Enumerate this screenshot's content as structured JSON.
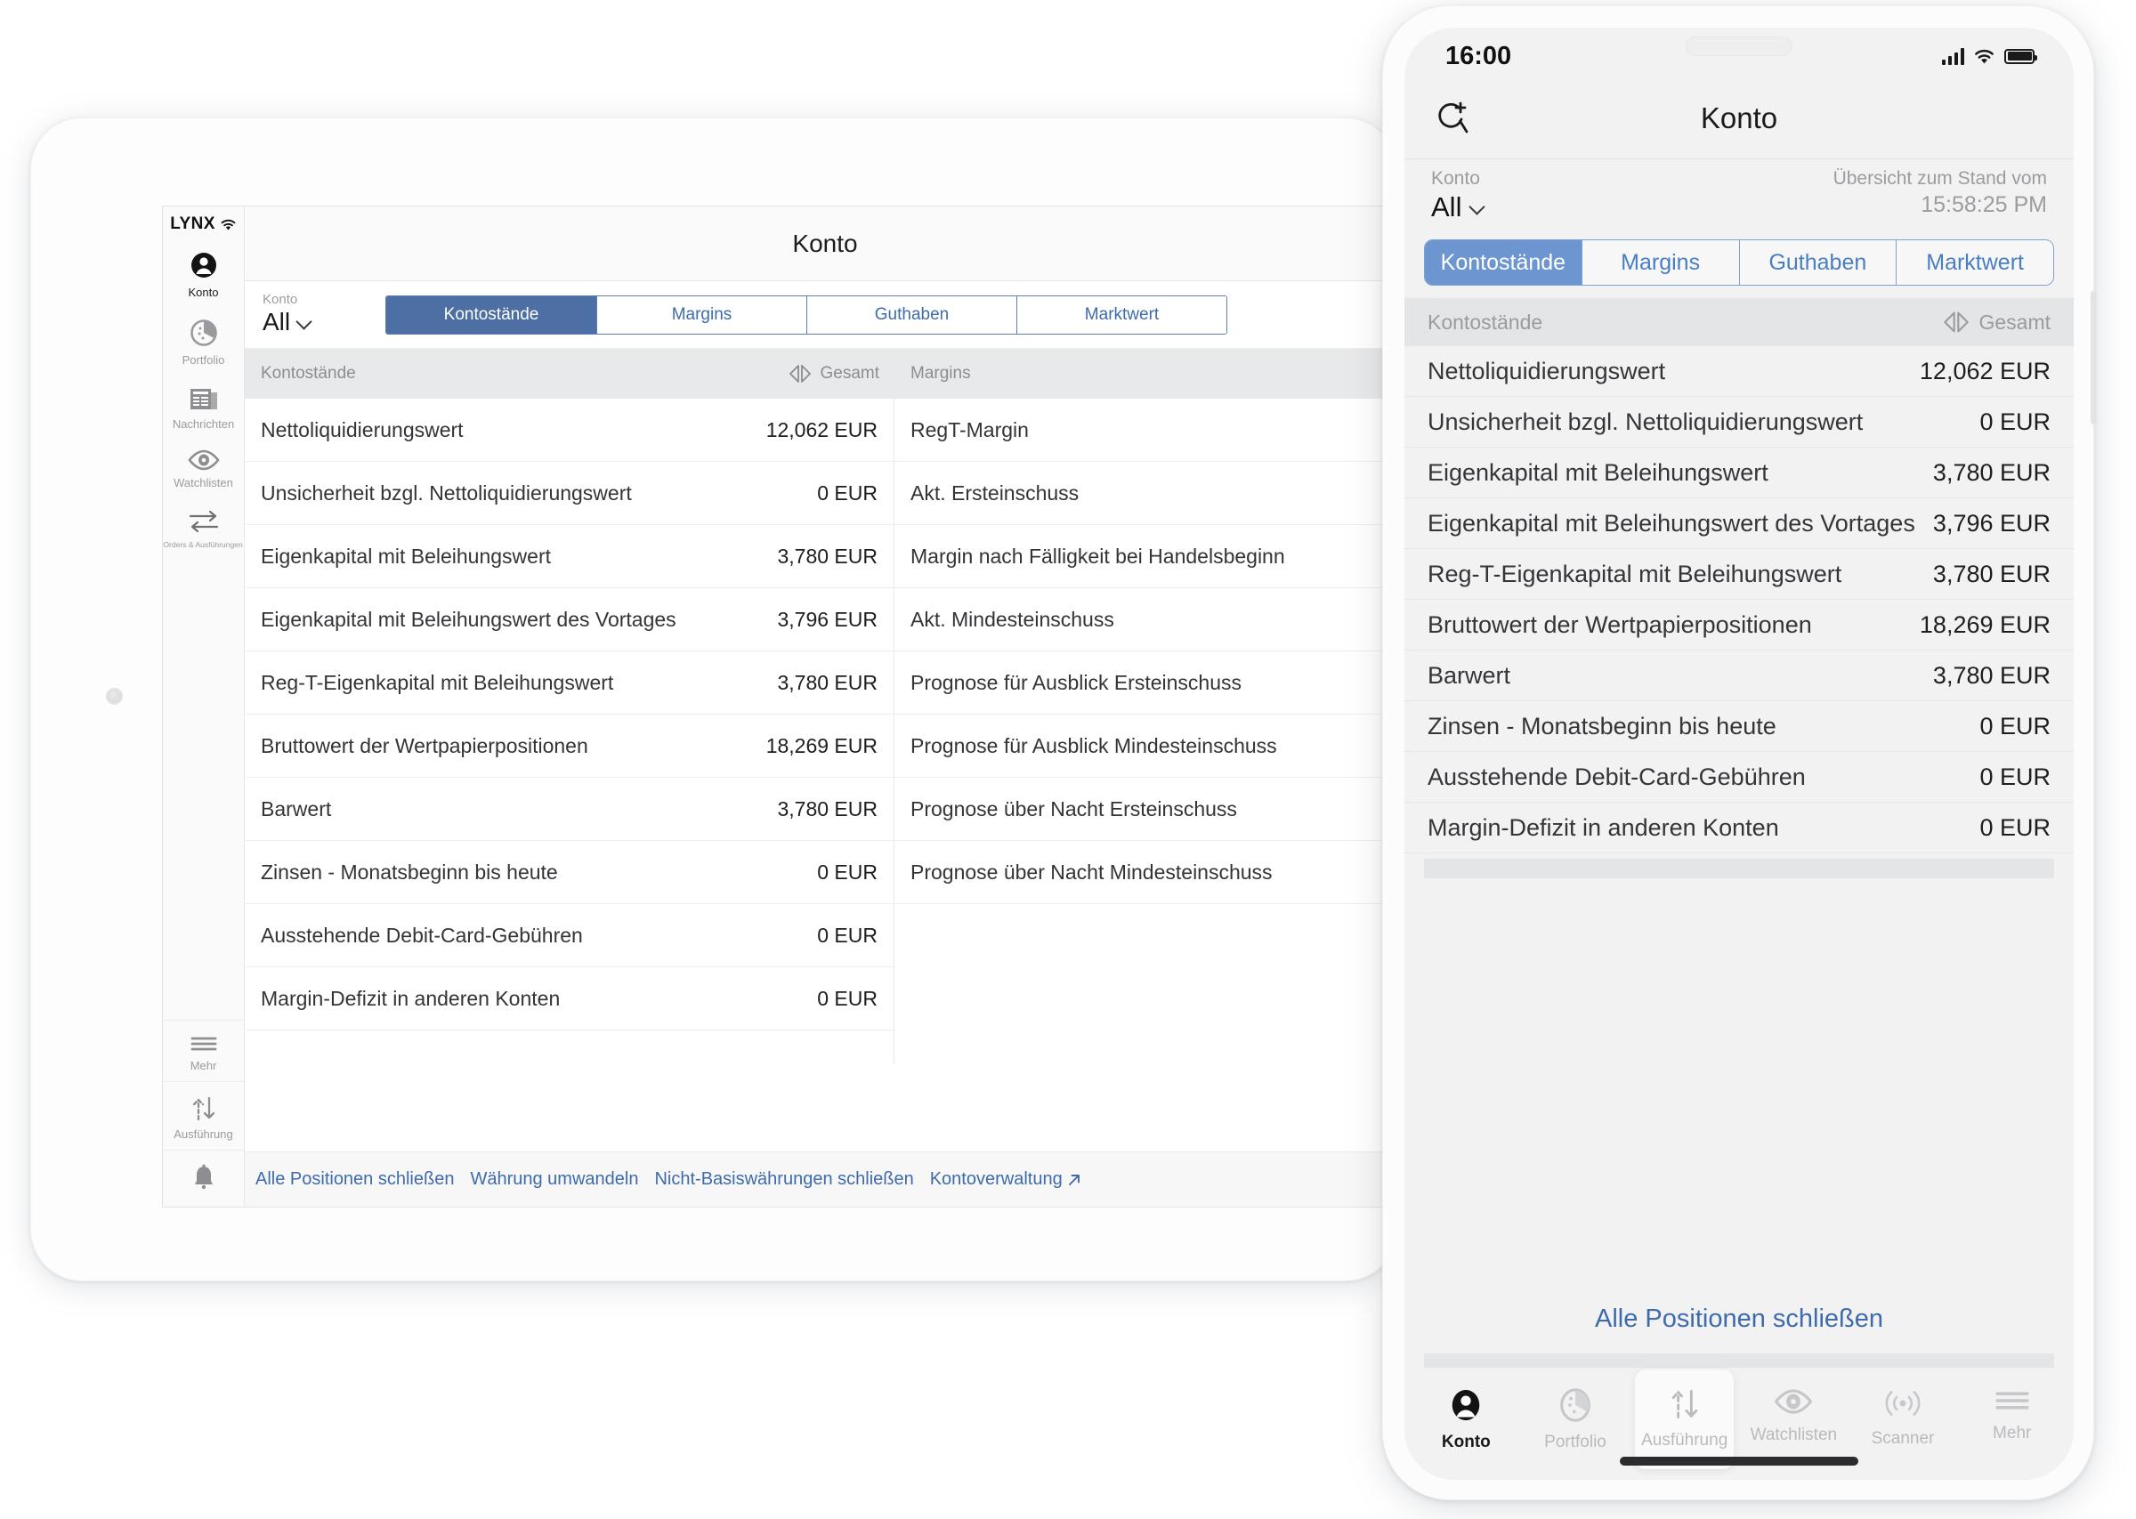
{
  "tablet": {
    "brand": "LYNX",
    "header_title": "Konto",
    "account": {
      "caption": "Konto",
      "value": "All"
    },
    "sidebar": [
      {
        "label": "Konto",
        "icon": "person-icon",
        "active": true
      },
      {
        "label": "Portfolio",
        "icon": "portfolio-pie-icon",
        "active": false
      },
      {
        "label": "Nachrichten",
        "icon": "news-icon",
        "active": false
      },
      {
        "label": "Watchlisten",
        "icon": "eye-icon",
        "active": false
      },
      {
        "label": "Orders & Ausführungen",
        "icon": "transfer-arrows-icon",
        "active": false
      }
    ],
    "sidebar_bottom": [
      {
        "label": "Mehr",
        "icon": "hamburger-icon"
      },
      {
        "label": "Ausführung",
        "icon": "up-down-arrows-icon"
      },
      {
        "label": "",
        "icon": "bell-icon"
      }
    ],
    "tabs": [
      {
        "label": "Kontostände",
        "active": true
      },
      {
        "label": "Margins",
        "active": false
      },
      {
        "label": "Guthaben",
        "active": false
      },
      {
        "label": "Marktwert",
        "active": false
      }
    ],
    "panel_kontostaende": {
      "header_title": "Kontostände",
      "header_right": "Gesamt",
      "rows": [
        {
          "label": "Nettoliquidierungswert",
          "value": "12,062 EUR"
        },
        {
          "label": "Unsicherheit bzgl. Nettoliquidierungswert",
          "value": "0 EUR"
        },
        {
          "label": "Eigenkapital mit Beleihungswert",
          "value": "3,780 EUR"
        },
        {
          "label": "Eigenkapital mit Beleihungswert des Vortages",
          "value": "3,796 EUR"
        },
        {
          "label": "Reg-T-Eigenkapital mit Beleihungswert",
          "value": "3,780 EUR"
        },
        {
          "label": "Bruttowert der Wertpapierpositionen",
          "value": "18,269 EUR"
        },
        {
          "label": "Barwert",
          "value": "3,780 EUR"
        },
        {
          "label": "Zinsen - Monatsbeginn bis heute",
          "value": "0 EUR"
        },
        {
          "label": "Ausstehende Debit-Card-Gebühren",
          "value": "0 EUR"
        },
        {
          "label": "Margin-Defizit in anderen Konten",
          "value": "0 EUR"
        }
      ]
    },
    "panel_margins": {
      "header_title": "Margins",
      "rows": [
        {
          "label": "RegT-Margin",
          "value": ""
        },
        {
          "label": "Akt. Ersteinschuss",
          "value": ""
        },
        {
          "label": "Margin nach Fälligkeit bei Handelsbeginn",
          "value": ""
        },
        {
          "label": "Akt. Mindesteinschuss",
          "value": ""
        },
        {
          "label": "Prognose für Ausblick Ersteinschuss",
          "value": ""
        },
        {
          "label": "Prognose für Ausblick Mindesteinschuss",
          "value": ""
        },
        {
          "label": "Prognose über Nacht Ersteinschuss",
          "value": ""
        },
        {
          "label": "Prognose über Nacht Mindesteinschuss",
          "value": ""
        }
      ]
    },
    "footer_links": [
      {
        "label": "Alle Positionen schließen",
        "external": false
      },
      {
        "label": "Währung umwandeln",
        "external": false
      },
      {
        "label": "Nicht-Basiswährungen schließen",
        "external": false
      },
      {
        "label": "Kontoverwaltung",
        "external": true
      }
    ]
  },
  "phone": {
    "status": {
      "clock": "16:00",
      "signal_icon": "cellular-bars-icon",
      "wifi_icon": "wifi-icon",
      "battery_icon": "battery-full-icon"
    },
    "navbar": {
      "title": "Konto",
      "left_icon": "add-search-icon"
    },
    "subbar": {
      "account_caption": "Konto",
      "account_value": "All",
      "timestamp_caption": "Übersicht zum Stand vom",
      "timestamp_value": "15:58:25 PM"
    },
    "tabs": [
      {
        "label": "Kontostände",
        "active": true
      },
      {
        "label": "Margins",
        "active": false
      },
      {
        "label": "Guthaben",
        "active": false
      },
      {
        "label": "Marktwert",
        "active": false
      }
    ],
    "list_header": {
      "title": "Kontostände",
      "right": "Gesamt",
      "icon": "expand-collapse-icon"
    },
    "rows": [
      {
        "label": "Nettoliquidierungswert",
        "value": "12,062 EUR"
      },
      {
        "label": "Unsicherheit bzgl. Nettoliquidierungswert",
        "value": "0 EUR"
      },
      {
        "label": "Eigenkapital mit Beleihungswert",
        "value": "3,780 EUR"
      },
      {
        "label": "Eigenkapital mit Beleihungswert des Vortages",
        "value": "3,796 EUR"
      },
      {
        "label": "Reg-T-Eigenkapital mit Beleihungswert",
        "value": "3,780 EUR"
      },
      {
        "label": "Bruttowert der Wertpapierpositionen",
        "value": "18,269 EUR"
      },
      {
        "label": "Barwert",
        "value": "3,780 EUR"
      },
      {
        "label": "Zinsen - Monatsbeginn bis heute",
        "value": "0 EUR"
      },
      {
        "label": "Ausstehende Debit-Card-Gebühren",
        "value": "0 EUR"
      },
      {
        "label": "Margin-Defizit in anderen Konten",
        "value": "0 EUR"
      }
    ],
    "action_label": "Alle Positionen schließen",
    "tabbar": [
      {
        "label": "Konto",
        "icon": "person-icon",
        "active": true,
        "raised": false
      },
      {
        "label": "Portfolio",
        "icon": "portfolio-pie-icon",
        "active": false,
        "raised": false
      },
      {
        "label": "Ausführung",
        "icon": "up-down-arrows-icon",
        "active": false,
        "raised": true
      },
      {
        "label": "Watchlisten",
        "icon": "eye-icon",
        "active": false,
        "raised": false
      },
      {
        "label": "Scanner",
        "icon": "scanner-waves-icon",
        "active": false,
        "raised": false
      },
      {
        "label": "Mehr",
        "icon": "hamburger-icon",
        "active": false,
        "raised": false
      }
    ]
  },
  "colors": {
    "accent_blue": "#3e6bab",
    "tablet_tab_active": "#4e6fa3",
    "phone_tab_active": "#6d96d1",
    "tab_border": "#7ba0d2"
  }
}
